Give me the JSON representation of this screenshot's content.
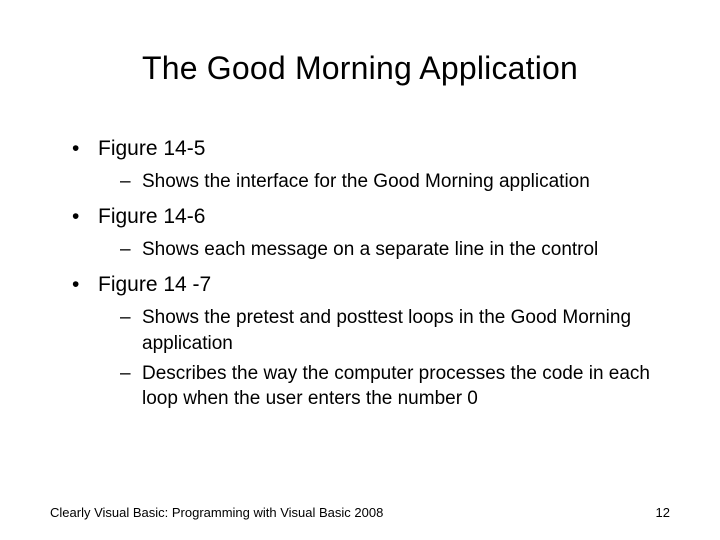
{
  "title": "The Good Morning Application",
  "bullets": {
    "b1": "Figure 14-5",
    "b1s1": "Shows the interface for the Good Morning application",
    "b2": "Figure 14-6",
    "b2s1": "Shows each message on a separate line in the control",
    "b3": "Figure 14 -7",
    "b3s1": "Shows the pretest and posttest loops in the Good Morning application",
    "b3s2": "Describes the way the computer processes the code in each loop when the user enters the number 0"
  },
  "footer": "Clearly Visual Basic: Programming with Visual Basic 2008",
  "page": "12"
}
